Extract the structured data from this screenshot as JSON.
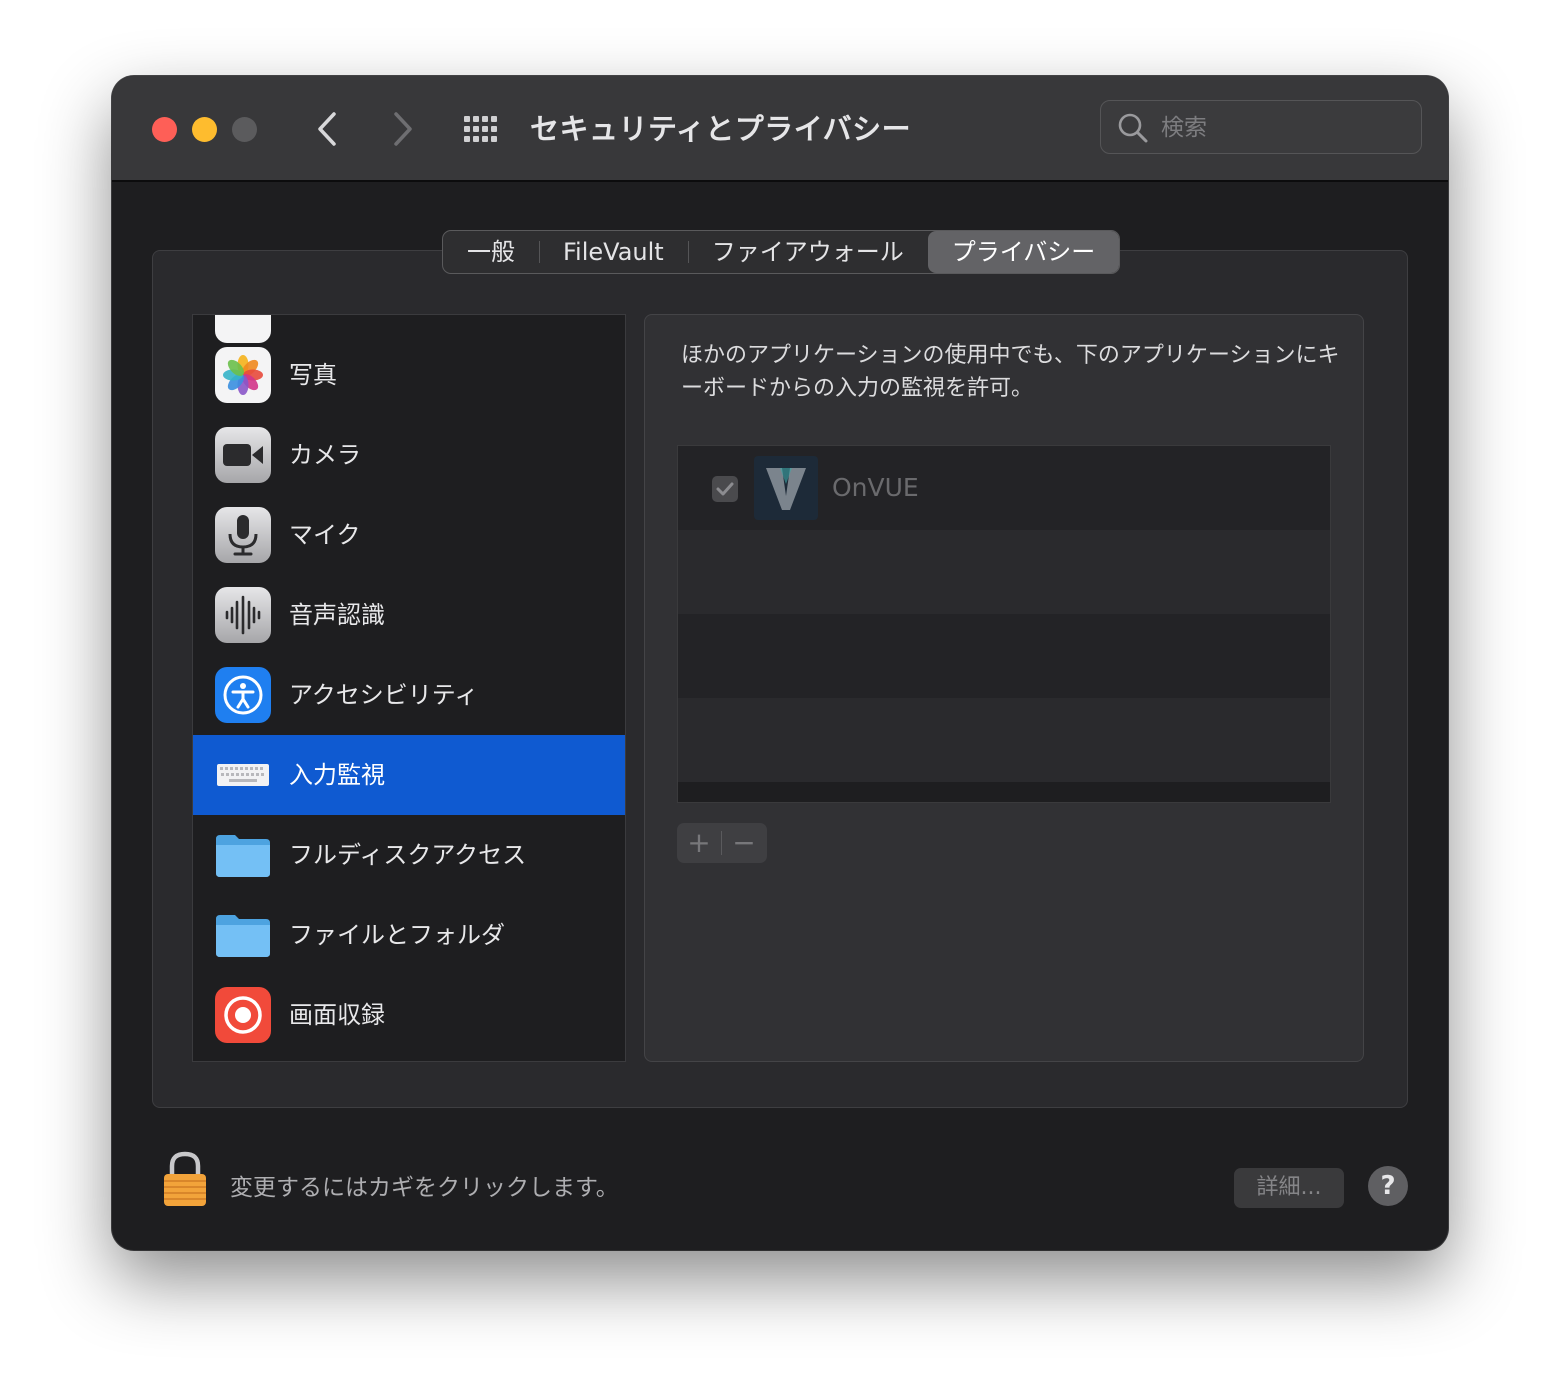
{
  "window": {
    "title": "セキュリティとプライバシー",
    "search": {
      "placeholder": "検索",
      "value": ""
    }
  },
  "tabs": [
    {
      "label": "一般",
      "active": false
    },
    {
      "label": "FileVault",
      "active": false
    },
    {
      "label": "ファイアウォール",
      "active": false
    },
    {
      "label": "プライバシー",
      "active": true
    }
  ],
  "sidebar": {
    "items": [
      {
        "label": "写真",
        "icon": "photos-icon"
      },
      {
        "label": "カメラ",
        "icon": "camera-icon"
      },
      {
        "label": "マイク",
        "icon": "microphone-icon"
      },
      {
        "label": "音声認識",
        "icon": "waveform-icon"
      },
      {
        "label": "アクセシビリティ",
        "icon": "accessibility-icon"
      },
      {
        "label": "入力監視",
        "icon": "keyboard-icon",
        "selected": true
      },
      {
        "label": "フルディスクアクセス",
        "icon": "folder-icon"
      },
      {
        "label": "ファイルとフォルダ",
        "icon": "folder-icon"
      },
      {
        "label": "画面収録",
        "icon": "screen-record-icon"
      }
    ]
  },
  "panel": {
    "description": "ほかのアプリケーションの使用中でも、下のアプリケーションにキーボードからの入力の監視を許可。",
    "apps": [
      {
        "name": "OnVUE",
        "checked": true,
        "icon": "onvue-icon"
      }
    ],
    "add_label": "+",
    "remove_label": "−"
  },
  "footer": {
    "lock_text": "変更するにはカギをクリックします。",
    "details_label": "詳細...",
    "help_label": "?"
  },
  "colors": {
    "selection": "#0f5ad1",
    "close": "#fe5f57",
    "minimize": "#febc2e"
  }
}
